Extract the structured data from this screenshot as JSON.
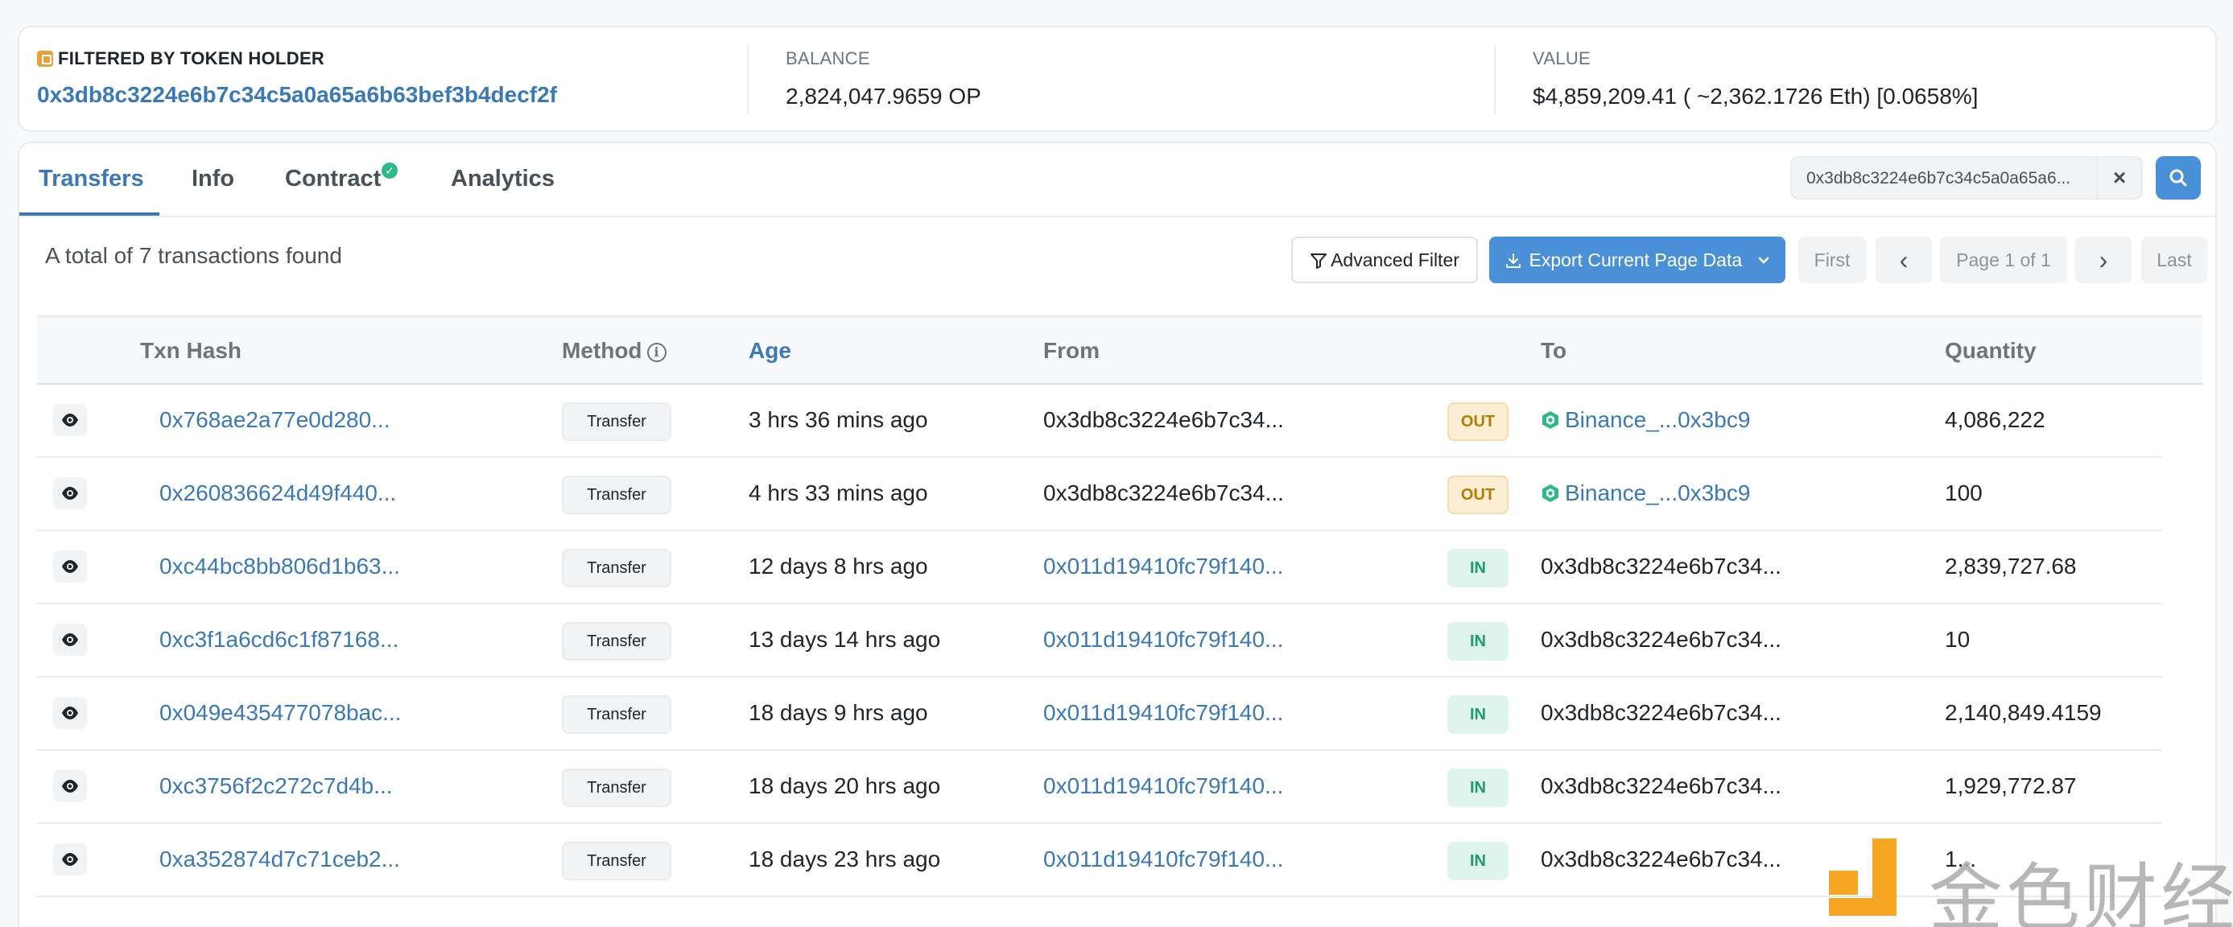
{
  "summary": {
    "holder_label": "FILTERED BY TOKEN HOLDER",
    "holder_address": "0x3db8c3224e6b7c34c5a0a65a6b63bef3b4decf2f",
    "balance_label": "BALANCE",
    "balance_value": "2,824,047.9659 OP",
    "value_label": "VALUE",
    "value_value": "$4,859,209.41 ( ~2,362.1726 Eth) [0.0658%]"
  },
  "tabs": [
    {
      "label": "Transfers",
      "active": true
    },
    {
      "label": "Info",
      "active": false
    },
    {
      "label": "Contract",
      "active": false,
      "verified": true
    },
    {
      "label": "Analytics",
      "active": false
    }
  ],
  "search": {
    "value": "0x3db8c3224e6b7c34c5a0a65a6...",
    "clear_icon": "close-icon",
    "button_icon": "search-icon"
  },
  "toolbar": {
    "total_text": "A total of 7 transactions found",
    "advanced_filter_label": "Advanced Filter",
    "export_label": "Export Current Page Data",
    "pagination": {
      "first": "First",
      "prev": "‹",
      "page": "Page 1 of 1",
      "next": "›",
      "last": "Last"
    }
  },
  "table": {
    "headers": {
      "txn_hash": "Txn Hash",
      "method": "Method",
      "age": "Age",
      "from": "From",
      "to": "To",
      "quantity": "Quantity"
    },
    "rows": [
      {
        "hash": "0x768ae2a77e0d280...",
        "method": "Transfer",
        "age": "3 hrs 36 mins ago",
        "from": "0x3db8c3224e6b7c34...",
        "from_link": false,
        "direction": "OUT",
        "to": "Binance_...0x3bc9",
        "to_link": true,
        "quantity": "4,086,222"
      },
      {
        "hash": "0x260836624d49f440...",
        "method": "Transfer",
        "age": "4 hrs 33 mins ago",
        "from": "0x3db8c3224e6b7c34...",
        "from_link": false,
        "direction": "OUT",
        "to": "Binance_...0x3bc9",
        "to_link": true,
        "quantity": "100"
      },
      {
        "hash": "0xc44bc8bb806d1b63...",
        "method": "Transfer",
        "age": "12 days 8 hrs ago",
        "from": "0x011d19410fc79f140...",
        "from_link": true,
        "direction": "IN",
        "to": "0x3db8c3224e6b7c34...",
        "to_link": false,
        "quantity": "2,839,727.68"
      },
      {
        "hash": "0xc3f1a6cd6c1f87168...",
        "method": "Transfer",
        "age": "13 days 14 hrs ago",
        "from": "0x011d19410fc79f140...",
        "from_link": true,
        "direction": "IN",
        "to": "0x3db8c3224e6b7c34...",
        "to_link": false,
        "quantity": "10"
      },
      {
        "hash": "0x049e435477078bac...",
        "method": "Transfer",
        "age": "18 days 9 hrs ago",
        "from": "0x011d19410fc79f140...",
        "from_link": true,
        "direction": "IN",
        "to": "0x3db8c3224e6b7c34...",
        "to_link": false,
        "quantity": "2,140,849.4159"
      },
      {
        "hash": "0xc3756f2c272c7d4b...",
        "method": "Transfer",
        "age": "18 days 20 hrs ago",
        "from": "0x011d19410fc79f140...",
        "from_link": true,
        "direction": "IN",
        "to": "0x3db8c3224e6b7c34...",
        "to_link": false,
        "quantity": "1,929,772.87"
      },
      {
        "hash": "0xa352874d7c71ceb2...",
        "method": "Transfer",
        "age": "18 days 23 hrs ago",
        "from": "0x011d19410fc79f140...",
        "from_link": true,
        "direction": "IN",
        "to": "0x3db8c3224e6b7c34...",
        "to_link": false,
        "quantity": "1..."
      }
    ]
  },
  "watermark": {
    "text": "金色财经"
  },
  "colors": {
    "link": "#3a79b7",
    "primary": "#4a90d9",
    "out_badge": "#b47d00",
    "in_badge": "#1e9c6e",
    "verified": "#2fb98b"
  }
}
